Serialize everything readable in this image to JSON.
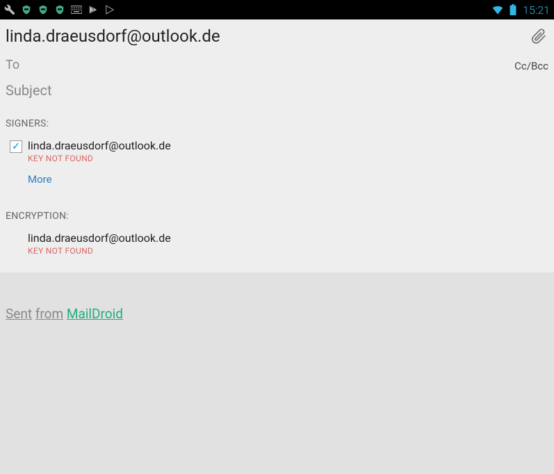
{
  "status": {
    "time": "15:21"
  },
  "compose": {
    "from_email": "linda.draeusdorf@outlook.de",
    "to_placeholder": "To",
    "ccbcc_label": "Cc/Bcc",
    "subject_placeholder": "Subject"
  },
  "signers": {
    "label": "SIGNERS:",
    "items": [
      {
        "email": "linda.draeusdorf@outlook.de",
        "key_status": "KEY NOT FOUND",
        "checked": true
      }
    ],
    "more_label": "More"
  },
  "encryption": {
    "label": "ENCRYPTION:",
    "items": [
      {
        "email": "linda.draeusdorf@outlook.de",
        "key_status": "KEY NOT FOUND"
      }
    ]
  },
  "signature": {
    "sent": "Sent",
    "from": "from",
    "app": "MailDroid"
  }
}
